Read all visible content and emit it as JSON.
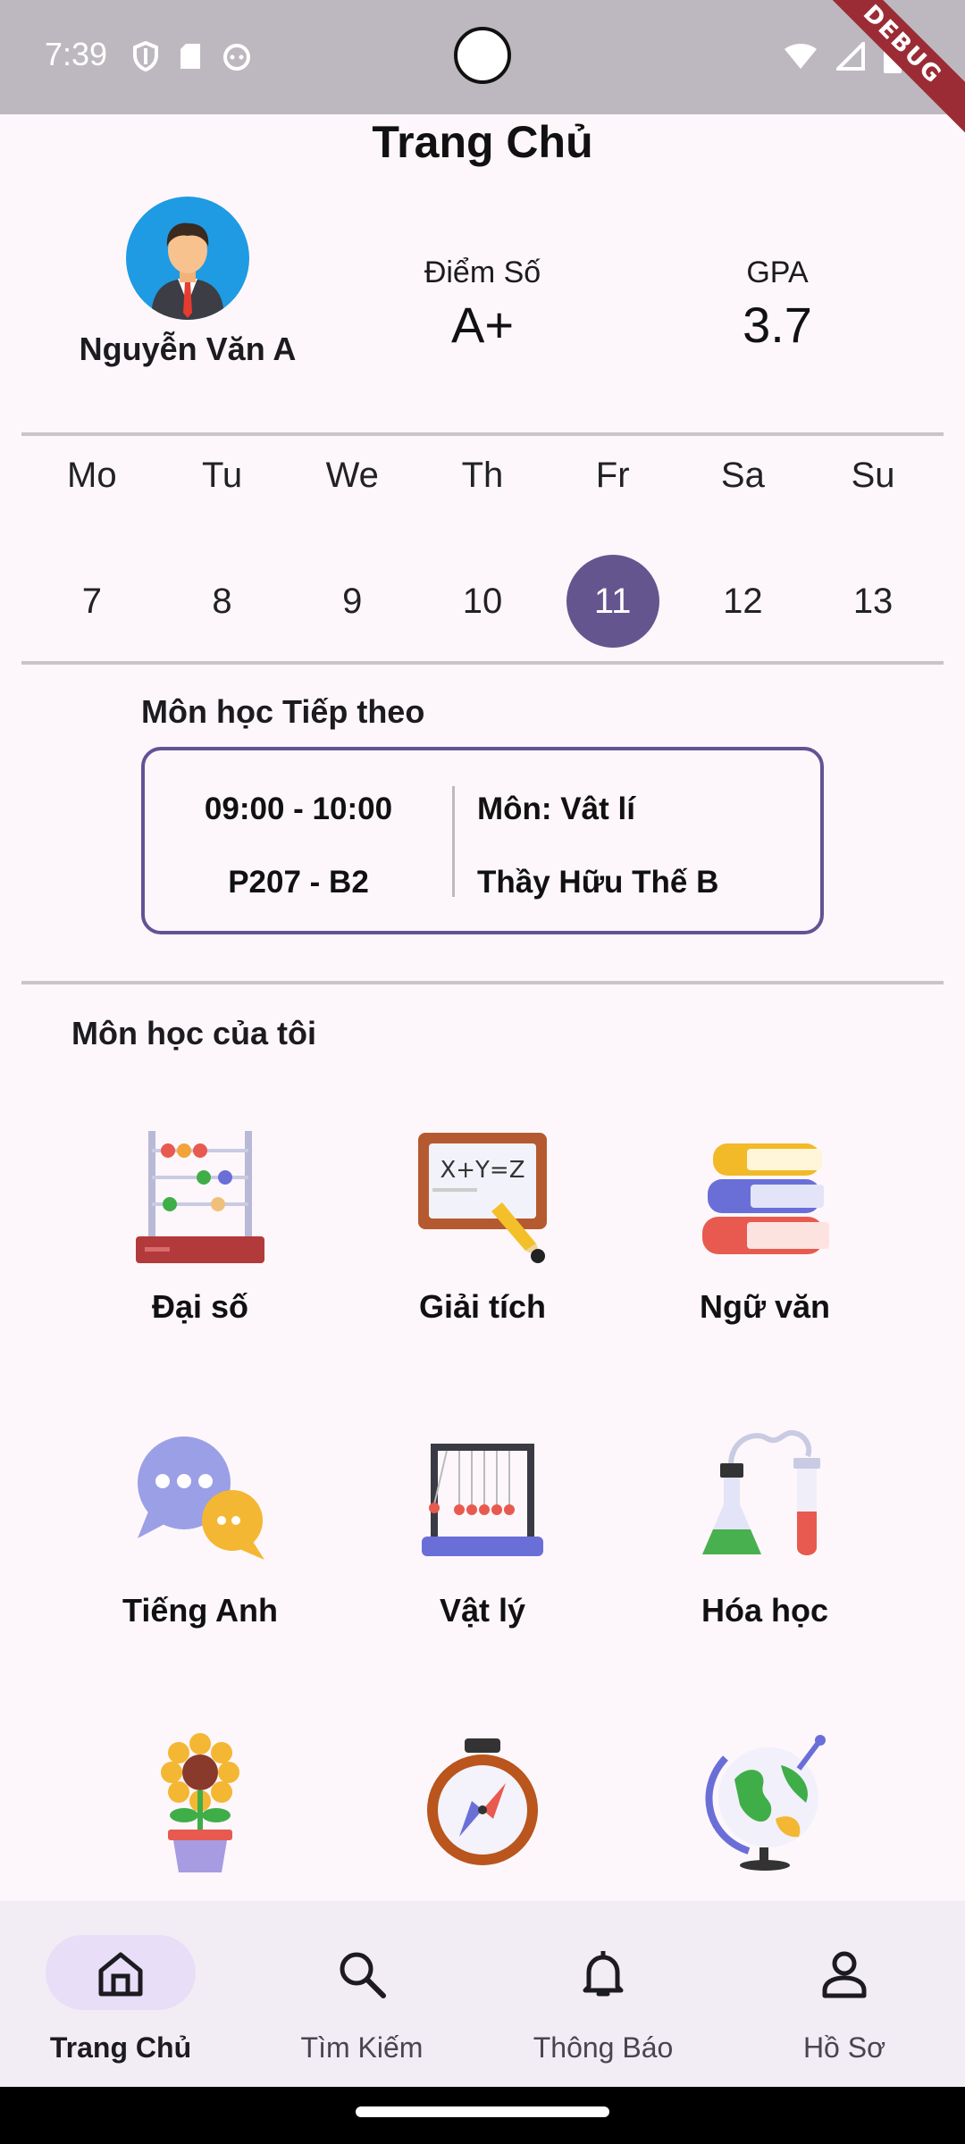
{
  "status_bar": {
    "time": "7:39",
    "debug_label": "DEBUG"
  },
  "header": {
    "title": "Trang Chủ"
  },
  "profile": {
    "name": "Nguyễn Văn A"
  },
  "stats": [
    {
      "label": "Điểm Số",
      "value": "A+"
    },
    {
      "label": "GPA",
      "value": "3.7"
    }
  ],
  "calendar": {
    "days": [
      "Mo",
      "Tu",
      "We",
      "Th",
      "Fr",
      "Sa",
      "Su"
    ],
    "dates": [
      "7",
      "8",
      "9",
      "10",
      "11",
      "12",
      "13"
    ],
    "selected": "11",
    "accent": "#65558f"
  },
  "next_class": {
    "heading": "Môn học Tiếp theo",
    "time": "09:00 - 10:00",
    "room": "P207 - B2",
    "subject": "Môn: Vât lí",
    "teacher": "Thầy Hữu Thế B"
  },
  "my_subjects": {
    "heading": "Môn học của tôi",
    "items": [
      {
        "label": "Đại số",
        "icon": "abacus-icon"
      },
      {
        "label": "Giải tích",
        "icon": "formula-board-icon"
      },
      {
        "label": "Ngữ văn",
        "icon": "books-icon"
      },
      {
        "label": "Tiếng Anh",
        "icon": "chat-bubbles-icon"
      },
      {
        "label": "Vật lý",
        "icon": "newtons-cradle-icon"
      },
      {
        "label": "Hóa học",
        "icon": "lab-flask-icon"
      },
      {
        "label": "",
        "icon": "flower-pot-icon"
      },
      {
        "label": "",
        "icon": "compass-icon"
      },
      {
        "label": "",
        "icon": "globe-icon"
      }
    ]
  },
  "bottom_nav": [
    {
      "label": "Trang Chủ",
      "icon": "home-icon",
      "active": true
    },
    {
      "label": "Tìm Kiếm",
      "icon": "search-icon",
      "active": false
    },
    {
      "label": "Thông Báo",
      "icon": "bell-icon",
      "active": false
    },
    {
      "label": "Hồ Sơ",
      "icon": "person-icon",
      "active": false
    }
  ]
}
